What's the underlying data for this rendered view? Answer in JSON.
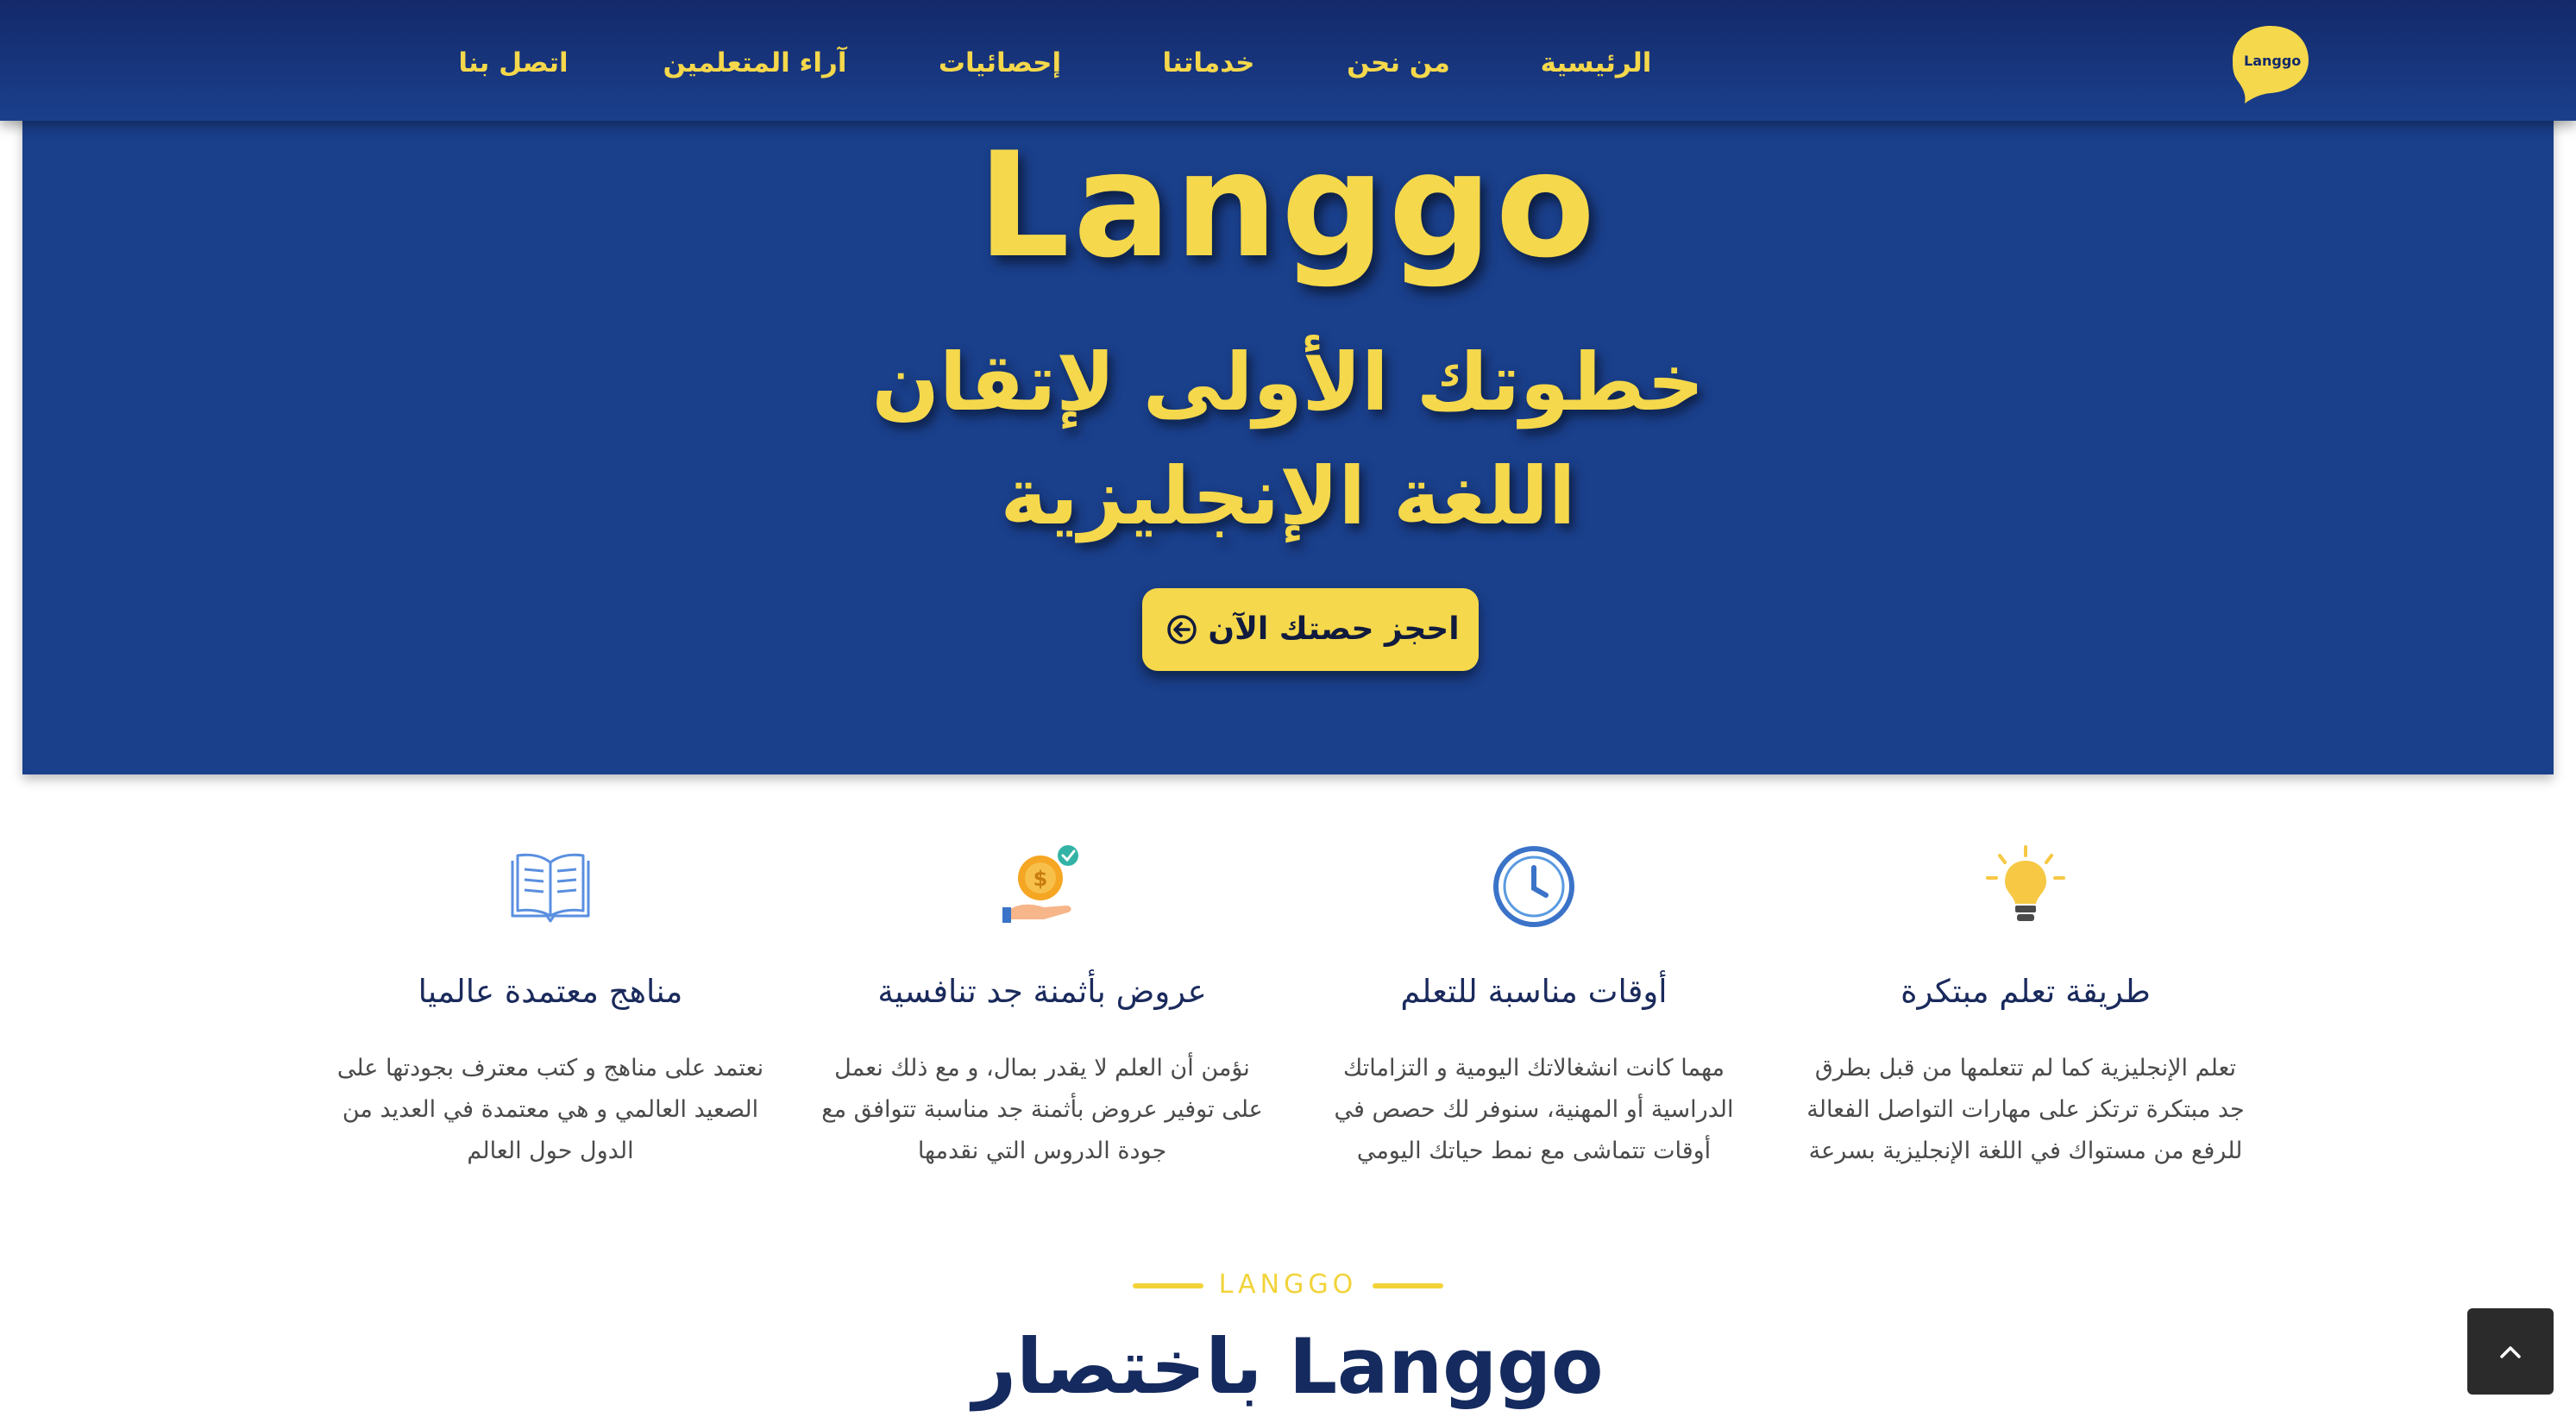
{
  "brand": {
    "logo_text": "Langgo",
    "accent_color": "#f5d84b",
    "primary_color": "#1a3f8b"
  },
  "nav": {
    "items": [
      {
        "label": "الرئيسية"
      },
      {
        "label": "من نحن"
      },
      {
        "label": "خدماتنا"
      },
      {
        "label": "إحصائيات"
      },
      {
        "label": "آراء المتعلمين"
      },
      {
        "label": "اتصل بنا"
      }
    ]
  },
  "hero": {
    "title": "Langgo",
    "subtitle": "خطوتك الأولى لإتقان اللغة الإنجليزية",
    "cta_label": "احجز حصتك الآن",
    "cta_icon": "arrow-left-circle-icon"
  },
  "features": [
    {
      "icon": "lightbulb-icon",
      "title": "طريقة تعلم مبتكرة",
      "desc": "تعلم الإنجليزية كما لم تتعلمها من قبل بطرق جد مبتكرة ترتكز على مهارات التواصل الفعالة للرفع من مستواك في اللغة الإنجليزية بسرعة"
    },
    {
      "icon": "clock-icon",
      "title": "أوقات مناسبة للتعلم",
      "desc": "مهما كانت انشغالاتك اليومية و التزاماتك الدراسية أو المهنية، سنوفر لك حصص في أوقات تتماشى مع نمط حياتك اليومي"
    },
    {
      "icon": "coin-hand-icon",
      "title": "عروض بأثمنة جد تنافسية",
      "desc": "نؤمن أن العلم لا يقدر بمال، و مع ذلك نعمل على توفير عروض بأثمنة جد مناسبة تتوافق مع جودة الدروس التي نقدمها"
    },
    {
      "icon": "open-book-icon",
      "title": "مناهج معتمدة عالميا",
      "desc": "نعتمد على مناهج و كتب معترف بجودتها على الصعيد العالمي و هي معتمدة في العديد من الدول حول العالم"
    }
  ],
  "about": {
    "eyebrow": "LANGGO",
    "title": "Langgo باختصار"
  },
  "back_to_top_icon": "chevron-up-icon"
}
